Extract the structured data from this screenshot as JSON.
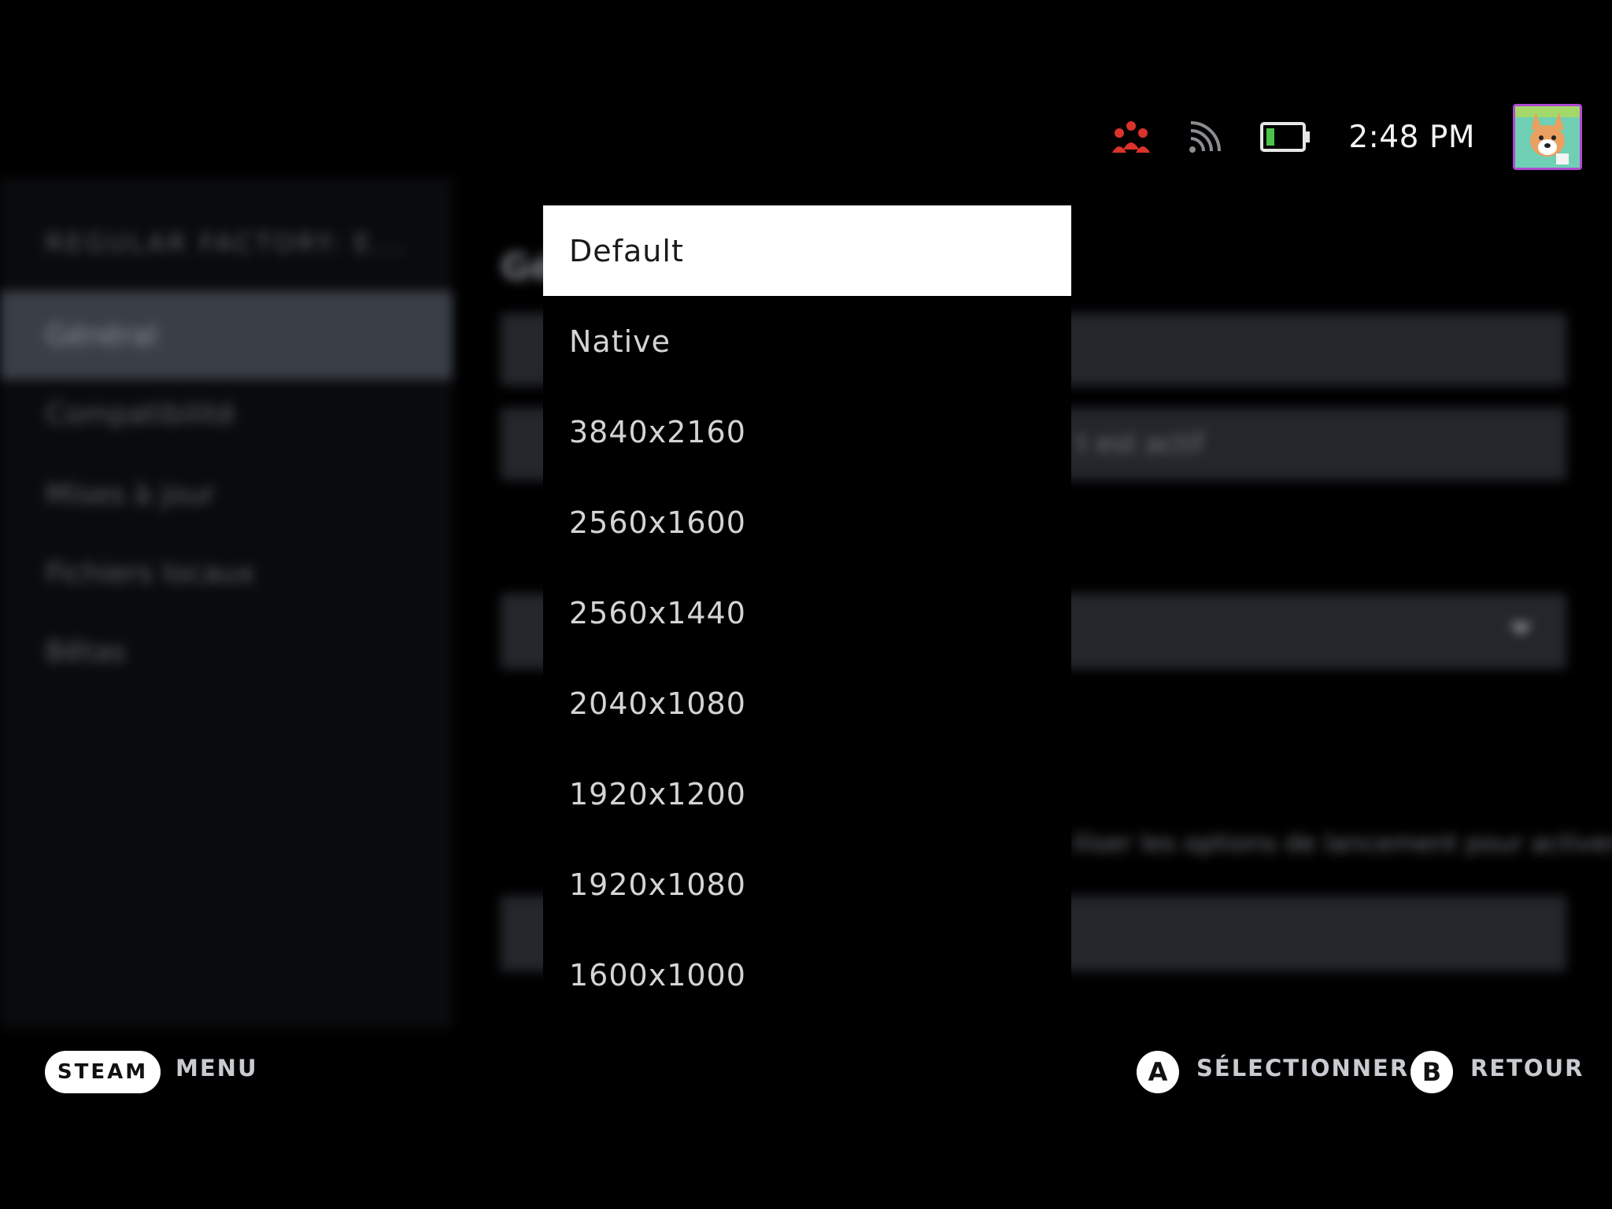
{
  "status_bar": {
    "clock": "2:48 PM",
    "icons": [
      "friends-icon",
      "wifi-icon",
      "battery-icon"
    ],
    "friends_color": "#d9332b",
    "battery_color": "#4cc44c"
  },
  "background": {
    "app_title": "REGULAR FACTORY: E...",
    "nav": [
      {
        "label": "Général",
        "selected": true
      },
      {
        "label": "Compatibilité"
      },
      {
        "label": "Mises à jour"
      },
      {
        "label": "Fichiers locaux"
      },
      {
        "label": "Bêtas"
      }
    ],
    "section_heading": "Gé",
    "checkbox_text": "t est actif",
    "launch_options_text": "iliser les options de lancement pour activer"
  },
  "dropdown": {
    "selected_index": 0,
    "options": [
      "Default",
      "Native",
      "3840x2160",
      "2560x1600",
      "2560x1440",
      "2040x1080",
      "1920x1200",
      "1920x1080",
      "1600x1000"
    ]
  },
  "footer": {
    "steam_label": "STEAM",
    "menu_label": "MENU",
    "a_glyph": "A",
    "select_label": "SÉLECTIONNER",
    "b_glyph": "B",
    "back_label": "RETOUR"
  }
}
